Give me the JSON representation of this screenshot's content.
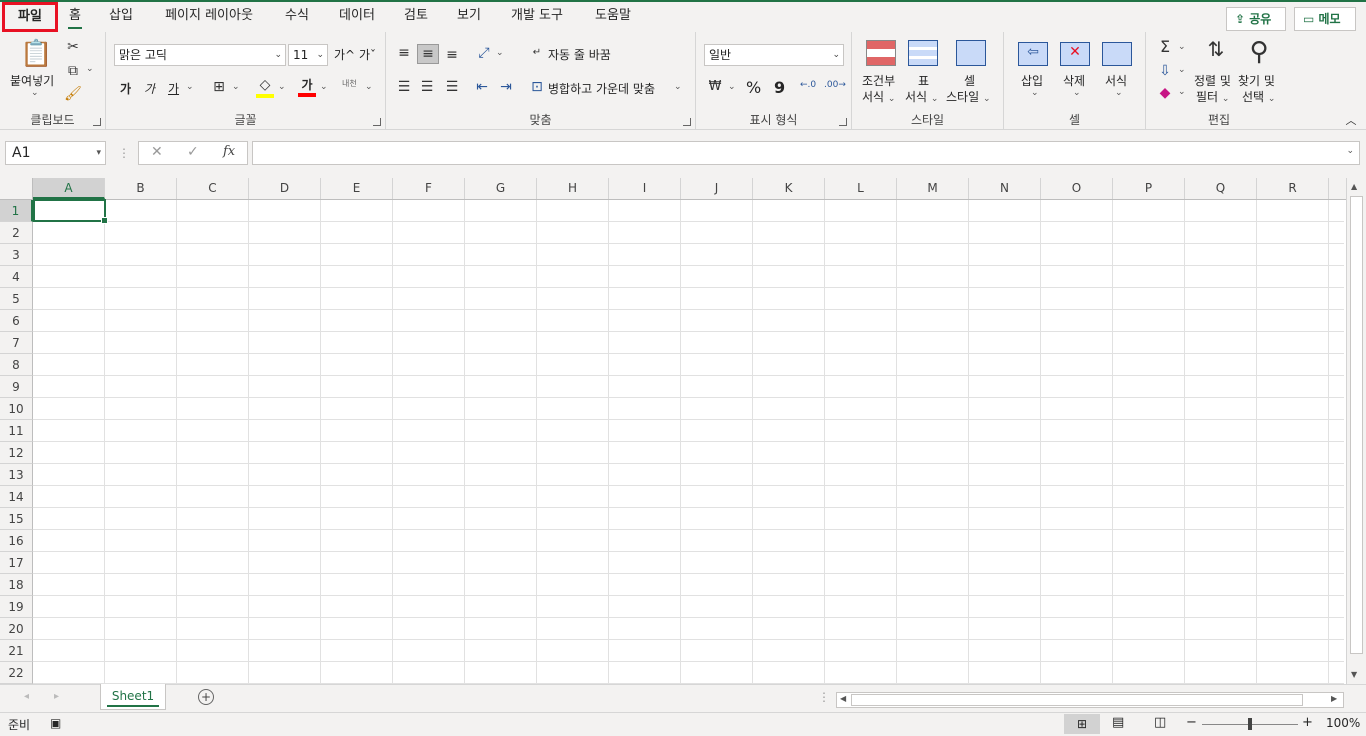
{
  "tabs": [
    {
      "key": "file",
      "label": "파일"
    },
    {
      "key": "home",
      "label": "홈"
    },
    {
      "key": "insert",
      "label": "삽입"
    },
    {
      "key": "layout",
      "label": "페이지 레이아웃"
    },
    {
      "key": "formulas",
      "label": "수식"
    },
    {
      "key": "data",
      "label": "데이터"
    },
    {
      "key": "review",
      "label": "검토"
    },
    {
      "key": "view",
      "label": "보기"
    },
    {
      "key": "developer",
      "label": "개발 도구"
    },
    {
      "key": "help",
      "label": "도움말"
    }
  ],
  "top_buttons": {
    "share": "공유",
    "comments": "메모"
  },
  "ribbon": {
    "clipboard": {
      "label": "클립보드",
      "paste": "붙여넣기"
    },
    "font": {
      "label": "글꼴",
      "font_name": "맑은 고딕",
      "font_size": "11",
      "grow": "가",
      "shrink": "가",
      "bold": "가",
      "italic": "가",
      "underline": "가",
      "color": "가",
      "phonetic": "내천"
    },
    "alignment": {
      "label": "맞춤",
      "wrap": "자동 줄 바꿈",
      "merge": "병합하고 가운데 맞춤"
    },
    "number": {
      "label": "표시 형식",
      "format": "일반",
      "percent": "%",
      "comma": "9",
      "inc": ".00",
      "dec": ".0"
    },
    "styles": {
      "label": "스타일",
      "conditional_1": "조건부",
      "conditional_2": "서식",
      "table_1": "표",
      "table_2": "서식",
      "cell_1": "셀",
      "cell_2": "스타일"
    },
    "cells": {
      "label": "셀",
      "insert": "삽입",
      "delete": "삭제",
      "format": "서식"
    },
    "editing": {
      "label": "편집",
      "sort_1": "정렬 및",
      "sort_2": "필터",
      "find_1": "찾기 및",
      "find_2": "선택",
      "sum": "Σ"
    }
  },
  "formula_bar": {
    "name_box": "A1",
    "fx": "fx",
    "cancel": "✕",
    "enter": "✓",
    "value": ""
  },
  "columns": [
    "A",
    "B",
    "C",
    "D",
    "E",
    "F",
    "G",
    "H",
    "I",
    "J",
    "K",
    "L",
    "M",
    "N",
    "O",
    "P",
    "Q",
    "R"
  ],
  "rows": [
    "1",
    "2",
    "3",
    "4",
    "5",
    "6",
    "7",
    "8",
    "9",
    "10",
    "11",
    "12",
    "13",
    "14",
    "15",
    "16",
    "17",
    "18",
    "19",
    "20",
    "21",
    "22"
  ],
  "sheets": [
    "Sheet1"
  ],
  "status": {
    "ready": "준비",
    "zoom": "100%",
    "minus": "−",
    "plus": "+"
  },
  "accent": "#217346"
}
